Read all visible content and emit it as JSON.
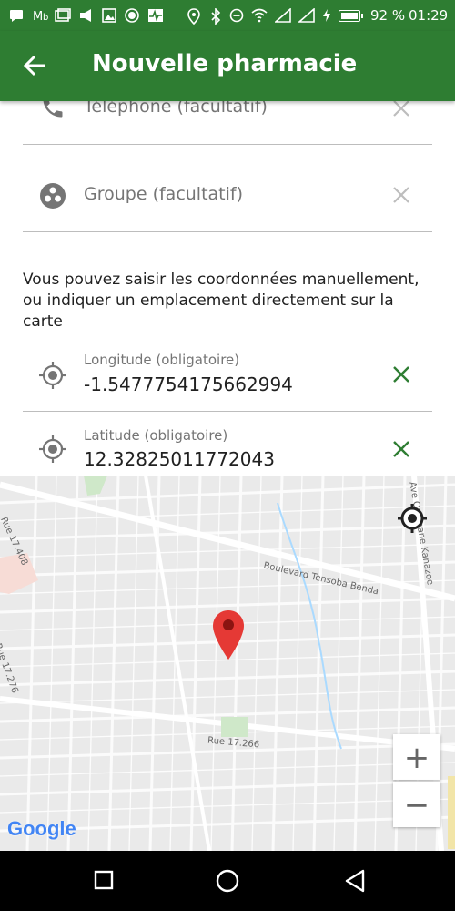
{
  "status_bar": {
    "battery_percent": "92 %",
    "time": "01:29"
  },
  "app_bar": {
    "title": "Nouvelle pharmacie"
  },
  "form": {
    "phone_placeholder": "Téléphone (facultatif)",
    "group_placeholder": "Groupe (facultatif)",
    "info_text": "Vous pouvez saisir les coordonnées manuellement, ou indiquer un emplacement directement sur la carte",
    "longitude": {
      "label": "Longitude (obligatoire)",
      "value": "-1.5477754175662994"
    },
    "latitude": {
      "label": "Latitude (obligatoire)",
      "value": "12.32825011772043"
    }
  },
  "map": {
    "street_labels": {
      "boulevard": "Boulevard Tensoba Benda",
      "rue_17_266": "Rue 17.266",
      "rue_17_276": "Rue 17.276",
      "rue_17_408": "Rue 17.408",
      "ave": "Ave Ousmane Kanazoe"
    },
    "zoom_in": "+",
    "zoom_out": "−",
    "logo": "Google"
  },
  "colors": {
    "primary": "#2e7d32",
    "action_green": "#2e7d32",
    "marker_red": "#e53935"
  }
}
